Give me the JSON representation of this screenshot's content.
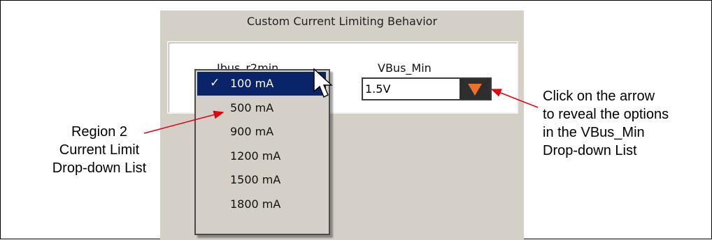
{
  "panel": {
    "title": "Custom Current Limiting Behavior",
    "ibus_label": "Ibus_r2min",
    "vbus_label": "VBus_Min"
  },
  "vbus_combo": {
    "value": "1.5V",
    "arrow_color": "#e8742a"
  },
  "dropdown": {
    "check_mark": "✓",
    "items": [
      {
        "label": "100 mA",
        "selected": true
      },
      {
        "label": "500 mA",
        "selected": false
      },
      {
        "label": "900 mA",
        "selected": false
      },
      {
        "label": "1200 mA",
        "selected": false
      },
      {
        "label": "1500 mA",
        "selected": false
      },
      {
        "label": "1800 mA",
        "selected": false
      }
    ]
  },
  "callouts": {
    "left_lines": [
      "Region 2",
      "Current Limit",
      "Drop-down List"
    ],
    "right_lines": [
      "Click on the arrow",
      "to reveal the options",
      "in the VBus_Min",
      "Drop-down List"
    ],
    "arrow_color": "#e0000f"
  },
  "colors": {
    "selection": "#0a246a",
    "panel": "#d4d0c8"
  }
}
